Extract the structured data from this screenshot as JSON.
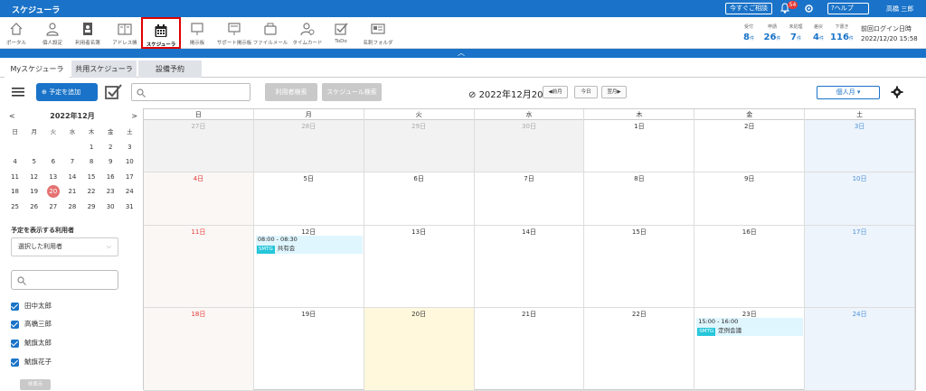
{
  "app": {
    "title": "スケジューラ"
  },
  "topbar": {
    "consult_label": "今すぐご相談",
    "notify_count": "54",
    "help_label": "?ヘルプ",
    "user_name": "高橋 三郎"
  },
  "tools": [
    {
      "label": "ポータル",
      "icon": "home-icon"
    },
    {
      "label": "個人設定",
      "icon": "person-icon"
    },
    {
      "label": "利用者名簿",
      "icon": "contact-book-icon"
    },
    {
      "label": "アドレス帳",
      "icon": "address-book-icon"
    },
    {
      "label": "スケジューラ",
      "icon": "calendar-icon"
    },
    {
      "label": "掲示板",
      "icon": "board-icon"
    },
    {
      "label": "サポート掲示板",
      "icon": "support-board-icon"
    },
    {
      "label": "ファイルメール",
      "icon": "file-mail-icon"
    },
    {
      "label": "タイムカード",
      "icon": "timecard-icon"
    },
    {
      "label": "ToDo",
      "icon": "todo-icon"
    },
    {
      "label": "名刺フォルダ",
      "icon": "business-card-icon"
    }
  ],
  "stats": [
    {
      "label": "受付",
      "value": "8",
      "unit": "件"
    },
    {
      "label": "申請",
      "value": "26",
      "unit": "件"
    },
    {
      "label": "未処理",
      "value": "7",
      "unit": "件"
    },
    {
      "label": "差戻",
      "value": "4",
      "unit": "件"
    },
    {
      "label": "下書き",
      "value": "116",
      "unit": "件"
    }
  ],
  "last_login": {
    "label": "前回ログイン日時",
    "value": "2022/12/20 15:58"
  },
  "tabs": [
    "Myスケジューラ",
    "共用スケジューラ",
    "設備予約"
  ],
  "controls": {
    "add_label": "予定を追加",
    "search_placeholder": "",
    "user_search_label": "利用者検索",
    "schedule_search_label": "スケジュール検索",
    "current_date": "2022年12月20日",
    "prev_label": "◀前月",
    "today_label": "今日",
    "next_label": "翌月▶",
    "view_label": "個人月 ▾"
  },
  "mini_calendar": {
    "title": "2022年12月",
    "prev": "<",
    "next": ">",
    "dow": [
      "日",
      "月",
      "火",
      "水",
      "木",
      "金",
      "土"
    ],
    "days": [
      "",
      "",
      "",
      "",
      "1",
      "2",
      "3",
      "4",
      "5",
      "6",
      "7",
      "8",
      "9",
      "10",
      "11",
      "12",
      "13",
      "14",
      "15",
      "16",
      "17",
      "18",
      "19",
      "20",
      "21",
      "22",
      "23",
      "24",
      "25",
      "26",
      "27",
      "28",
      "29",
      "30",
      "31"
    ],
    "today": "20"
  },
  "users_section": {
    "title": "予定を表示する利用者",
    "select_value": "選択した利用者",
    "users": [
      "田中太郎",
      "高橋三郎",
      "鯱旗太郎",
      "鯱旗花子"
    ],
    "hide_label": "非表示"
  },
  "calendar": {
    "dow": [
      "日",
      "月",
      "火",
      "水",
      "木",
      "金",
      "土"
    ],
    "weeks": [
      [
        "27日",
        "28日",
        "29日",
        "30日",
        "1日",
        "2日",
        "3日"
      ],
      [
        "4日",
        "5日",
        "6日",
        "7日",
        "8日",
        "9日",
        "10日"
      ],
      [
        "11日",
        "12日",
        "13日",
        "14日",
        "15日",
        "16日",
        "17日"
      ],
      [
        "18日",
        "19日",
        "20日",
        "21日",
        "22日",
        "23日",
        "24日"
      ]
    ],
    "events": [
      {
        "time": "08:00 - 08:30",
        "tag": "SMTG",
        "title": "共有会"
      },
      {
        "time": "15:00 - 16:00",
        "tag": "SMTG",
        "title": "定例会議"
      }
    ]
  }
}
